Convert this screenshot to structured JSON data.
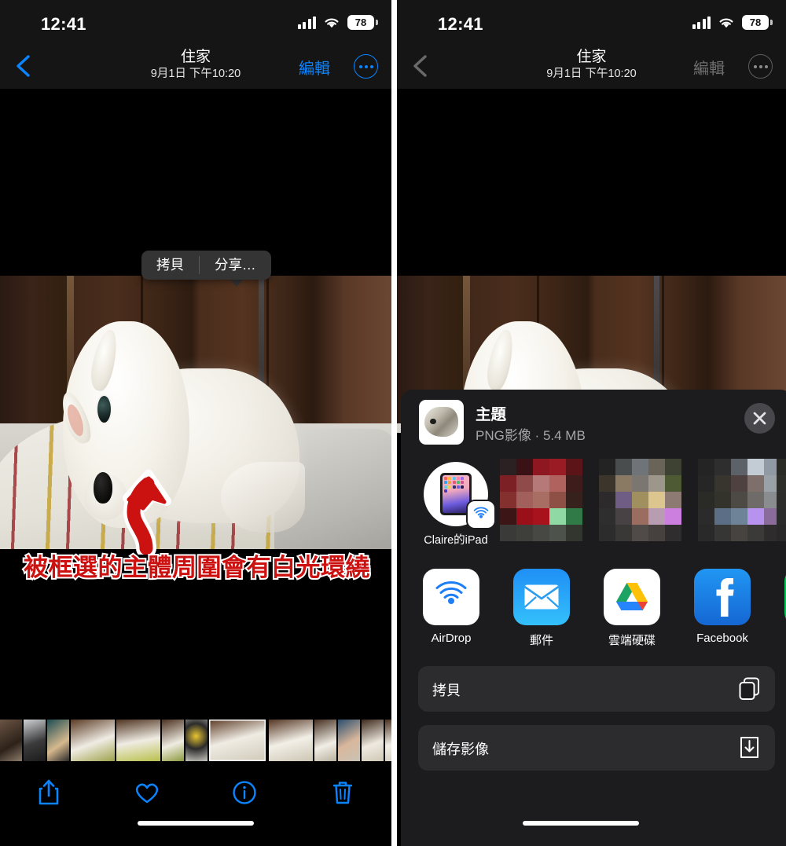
{
  "meta": {
    "app": "Photos",
    "platform": "iOS"
  },
  "status_bar": {
    "time": "12:41",
    "battery_level": "78",
    "cellular_icon": "cellular-bars-icon",
    "wifi_icon": "wifi-icon",
    "battery_icon": "battery-icon"
  },
  "nav_bar": {
    "back_icon": "chevron-left-icon",
    "title": "住家",
    "subtitle": "9月1日  下午10:20",
    "edit_label": "編輯",
    "more_icon": "ellipsis-circle-icon"
  },
  "left_panel": {
    "popover": {
      "copy_label": "拷貝",
      "share_label": "分享…"
    },
    "annotation": {
      "text": "被框選的主體周圍會有白光環繞",
      "text_color": "#cc1111",
      "outline_color": "#ffffff",
      "arrow_icon": "curved-up-arrow-icon",
      "arrow_color": "#cc1111"
    },
    "toolbar": {
      "share_icon": "share-up-icon",
      "favorite_icon": "heart-icon",
      "info_icon": "info-circle-icon",
      "delete_icon": "trash-icon",
      "tint": "#0a84ff"
    }
  },
  "right_panel": {
    "share_sheet": {
      "header": {
        "title": "主題",
        "subtitle": "PNG影像 · 5.4 MB",
        "thumbnail_icon": "photo-subject-thumbnail",
        "close_icon": "close-x-icon"
      },
      "airdrop": {
        "contacts": [
          {
            "name": "Claire的iPad",
            "device_icon": "ipad-icon",
            "badge_icon": "airdrop-badge-icon"
          }
        ],
        "redacted_count": 4
      },
      "apps": [
        {
          "name": "AirDrop",
          "icon": "airdrop-icon",
          "color": "#ffffff"
        },
        {
          "name": "郵件",
          "icon": "mail-icon",
          "color": "#1d9bf6"
        },
        {
          "name": "雲端硬碟",
          "icon": "google-drive-icon",
          "color": "#ffffff"
        },
        {
          "name": "Facebook",
          "icon": "facebook-icon",
          "color": "#1877f2"
        },
        {
          "name": "",
          "icon": "line-icon",
          "color": "#06c755"
        }
      ],
      "actions": [
        {
          "label": "拷貝",
          "icon": "copy-icon"
        },
        {
          "label": "儲存影像",
          "icon": "save-download-icon"
        }
      ]
    }
  },
  "colors": {
    "ios_blue": "#0a84ff",
    "sheet_bg": "#1c1c1e",
    "row_bg": "#2c2c2e",
    "chrome_bg": "#151515",
    "annotation_red": "#cc1111"
  }
}
